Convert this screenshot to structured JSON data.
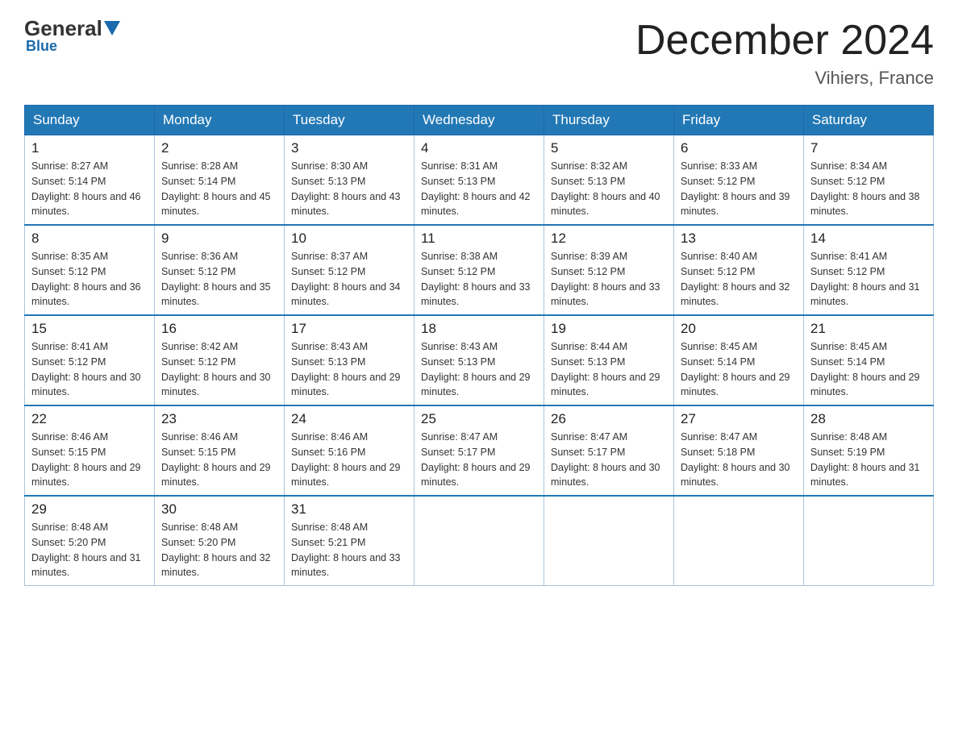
{
  "header": {
    "logo": {
      "part1": "General",
      "part2": "Blue"
    },
    "title": "December 2024",
    "location": "Vihiers, France"
  },
  "days_of_week": [
    "Sunday",
    "Monday",
    "Tuesday",
    "Wednesday",
    "Thursday",
    "Friday",
    "Saturday"
  ],
  "weeks": [
    [
      {
        "day": "1",
        "sunrise": "8:27 AM",
        "sunset": "5:14 PM",
        "daylight": "8 hours and 46 minutes."
      },
      {
        "day": "2",
        "sunrise": "8:28 AM",
        "sunset": "5:14 PM",
        "daylight": "8 hours and 45 minutes."
      },
      {
        "day": "3",
        "sunrise": "8:30 AM",
        "sunset": "5:13 PM",
        "daylight": "8 hours and 43 minutes."
      },
      {
        "day": "4",
        "sunrise": "8:31 AM",
        "sunset": "5:13 PM",
        "daylight": "8 hours and 42 minutes."
      },
      {
        "day": "5",
        "sunrise": "8:32 AM",
        "sunset": "5:13 PM",
        "daylight": "8 hours and 40 minutes."
      },
      {
        "day": "6",
        "sunrise": "8:33 AM",
        "sunset": "5:12 PM",
        "daylight": "8 hours and 39 minutes."
      },
      {
        "day": "7",
        "sunrise": "8:34 AM",
        "sunset": "5:12 PM",
        "daylight": "8 hours and 38 minutes."
      }
    ],
    [
      {
        "day": "8",
        "sunrise": "8:35 AM",
        "sunset": "5:12 PM",
        "daylight": "8 hours and 36 minutes."
      },
      {
        "day": "9",
        "sunrise": "8:36 AM",
        "sunset": "5:12 PM",
        "daylight": "8 hours and 35 minutes."
      },
      {
        "day": "10",
        "sunrise": "8:37 AM",
        "sunset": "5:12 PM",
        "daylight": "8 hours and 34 minutes."
      },
      {
        "day": "11",
        "sunrise": "8:38 AM",
        "sunset": "5:12 PM",
        "daylight": "8 hours and 33 minutes."
      },
      {
        "day": "12",
        "sunrise": "8:39 AM",
        "sunset": "5:12 PM",
        "daylight": "8 hours and 33 minutes."
      },
      {
        "day": "13",
        "sunrise": "8:40 AM",
        "sunset": "5:12 PM",
        "daylight": "8 hours and 32 minutes."
      },
      {
        "day": "14",
        "sunrise": "8:41 AM",
        "sunset": "5:12 PM",
        "daylight": "8 hours and 31 minutes."
      }
    ],
    [
      {
        "day": "15",
        "sunrise": "8:41 AM",
        "sunset": "5:12 PM",
        "daylight": "8 hours and 30 minutes."
      },
      {
        "day": "16",
        "sunrise": "8:42 AM",
        "sunset": "5:12 PM",
        "daylight": "8 hours and 30 minutes."
      },
      {
        "day": "17",
        "sunrise": "8:43 AM",
        "sunset": "5:13 PM",
        "daylight": "8 hours and 29 minutes."
      },
      {
        "day": "18",
        "sunrise": "8:43 AM",
        "sunset": "5:13 PM",
        "daylight": "8 hours and 29 minutes."
      },
      {
        "day": "19",
        "sunrise": "8:44 AM",
        "sunset": "5:13 PM",
        "daylight": "8 hours and 29 minutes."
      },
      {
        "day": "20",
        "sunrise": "8:45 AM",
        "sunset": "5:14 PM",
        "daylight": "8 hours and 29 minutes."
      },
      {
        "day": "21",
        "sunrise": "8:45 AM",
        "sunset": "5:14 PM",
        "daylight": "8 hours and 29 minutes."
      }
    ],
    [
      {
        "day": "22",
        "sunrise": "8:46 AM",
        "sunset": "5:15 PM",
        "daylight": "8 hours and 29 minutes."
      },
      {
        "day": "23",
        "sunrise": "8:46 AM",
        "sunset": "5:15 PM",
        "daylight": "8 hours and 29 minutes."
      },
      {
        "day": "24",
        "sunrise": "8:46 AM",
        "sunset": "5:16 PM",
        "daylight": "8 hours and 29 minutes."
      },
      {
        "day": "25",
        "sunrise": "8:47 AM",
        "sunset": "5:17 PM",
        "daylight": "8 hours and 29 minutes."
      },
      {
        "day": "26",
        "sunrise": "8:47 AM",
        "sunset": "5:17 PM",
        "daylight": "8 hours and 30 minutes."
      },
      {
        "day": "27",
        "sunrise": "8:47 AM",
        "sunset": "5:18 PM",
        "daylight": "8 hours and 30 minutes."
      },
      {
        "day": "28",
        "sunrise": "8:48 AM",
        "sunset": "5:19 PM",
        "daylight": "8 hours and 31 minutes."
      }
    ],
    [
      {
        "day": "29",
        "sunrise": "8:48 AM",
        "sunset": "5:20 PM",
        "daylight": "8 hours and 31 minutes."
      },
      {
        "day": "30",
        "sunrise": "8:48 AM",
        "sunset": "5:20 PM",
        "daylight": "8 hours and 32 minutes."
      },
      {
        "day": "31",
        "sunrise": "8:48 AM",
        "sunset": "5:21 PM",
        "daylight": "8 hours and 33 minutes."
      },
      null,
      null,
      null,
      null
    ]
  ]
}
